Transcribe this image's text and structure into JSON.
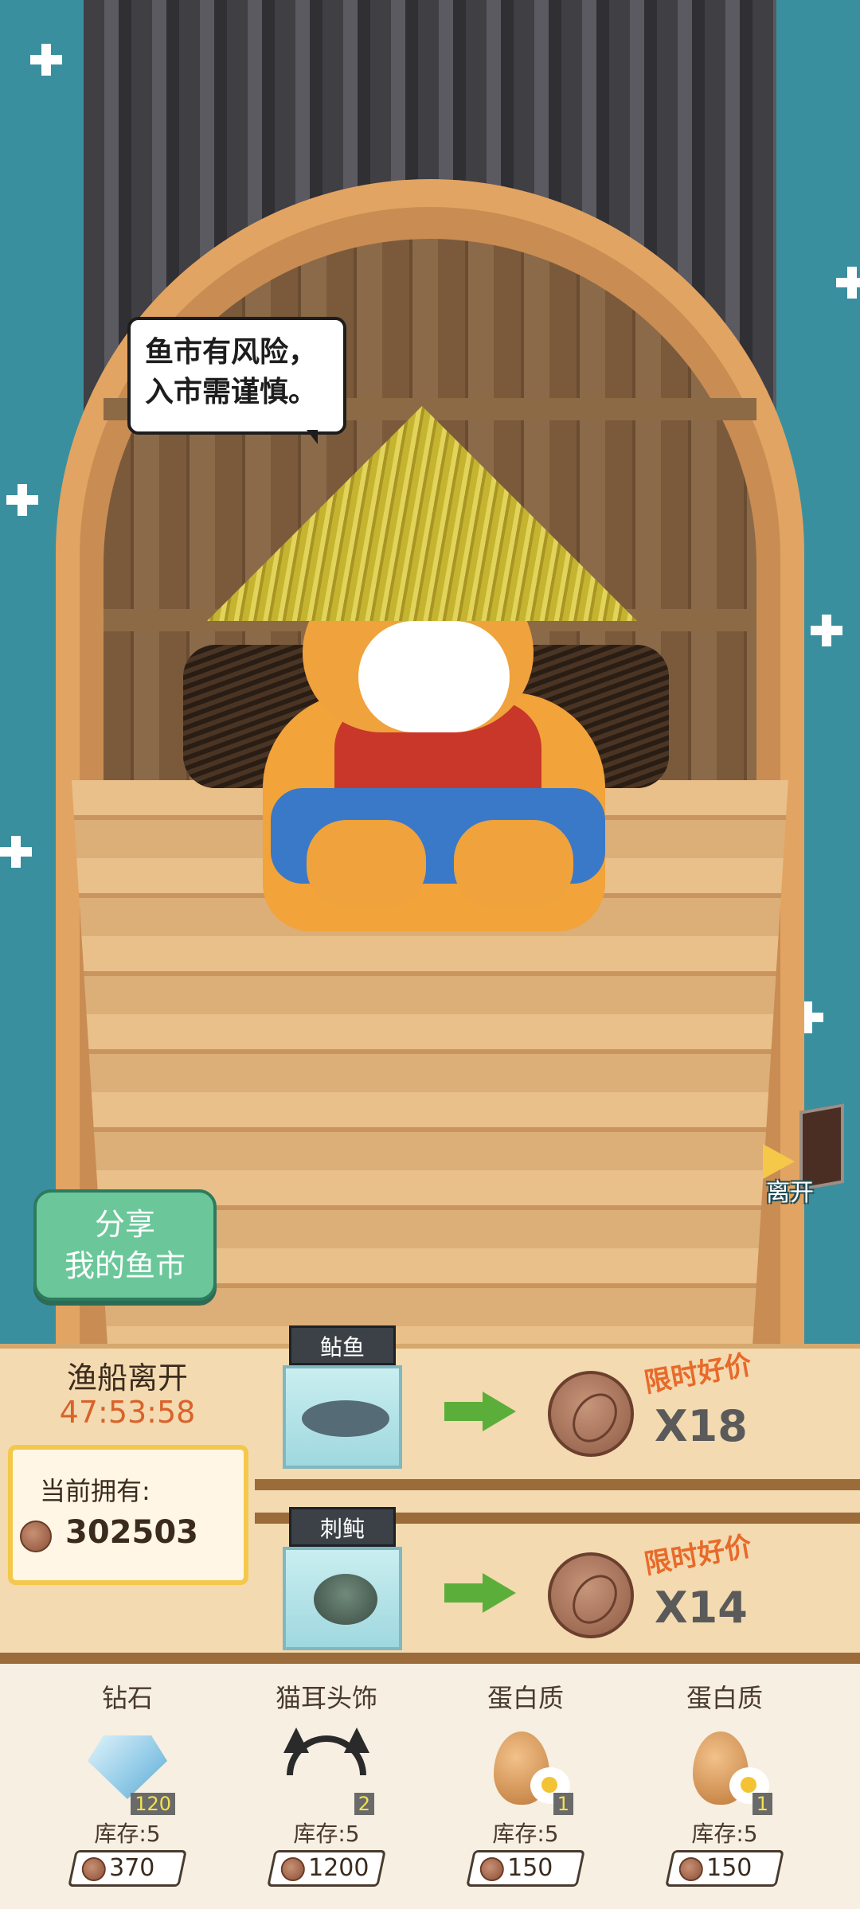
{
  "speech_bubble": {
    "line1": "鱼市有风险，",
    "line2": "入市需谨慎。"
  },
  "share_button": {
    "line1": "分享",
    "line2": "我的鱼市"
  },
  "exit_button": {
    "label": "离开",
    "icon": "door-exit-icon"
  },
  "market": {
    "boat_leave_label": "渔船离开",
    "countdown": "47:53:58",
    "owned_label": "当前拥有:",
    "owned_value": "302503",
    "offers": [
      {
        "fish_name": "鲇鱼",
        "promo": "限时好价",
        "price": "X18"
      },
      {
        "fish_name": "刺鲀",
        "promo": "限时好价",
        "price": "X14"
      }
    ]
  },
  "shop": {
    "items": [
      {
        "name": "钻石",
        "badge": "120",
        "stock": "库存:5",
        "price": "370",
        "icon": "diamond-icon"
      },
      {
        "name": "猫耳头饰",
        "badge": "2",
        "stock": "库存:5",
        "price": "1200",
        "icon": "cat-ear-headband-icon"
      },
      {
        "name": "蛋白质",
        "badge": "1",
        "stock": "库存:5",
        "price": "150",
        "icon": "egg-icon"
      },
      {
        "name": "蛋白质",
        "badge": "1",
        "stock": "库存:5",
        "price": "150",
        "icon": "egg-icon"
      }
    ]
  },
  "colors": {
    "sea": "#3a8f9f",
    "panel": "#f3dab0",
    "accent_orange": "#d9622b",
    "share_green": "#6bc79a"
  }
}
